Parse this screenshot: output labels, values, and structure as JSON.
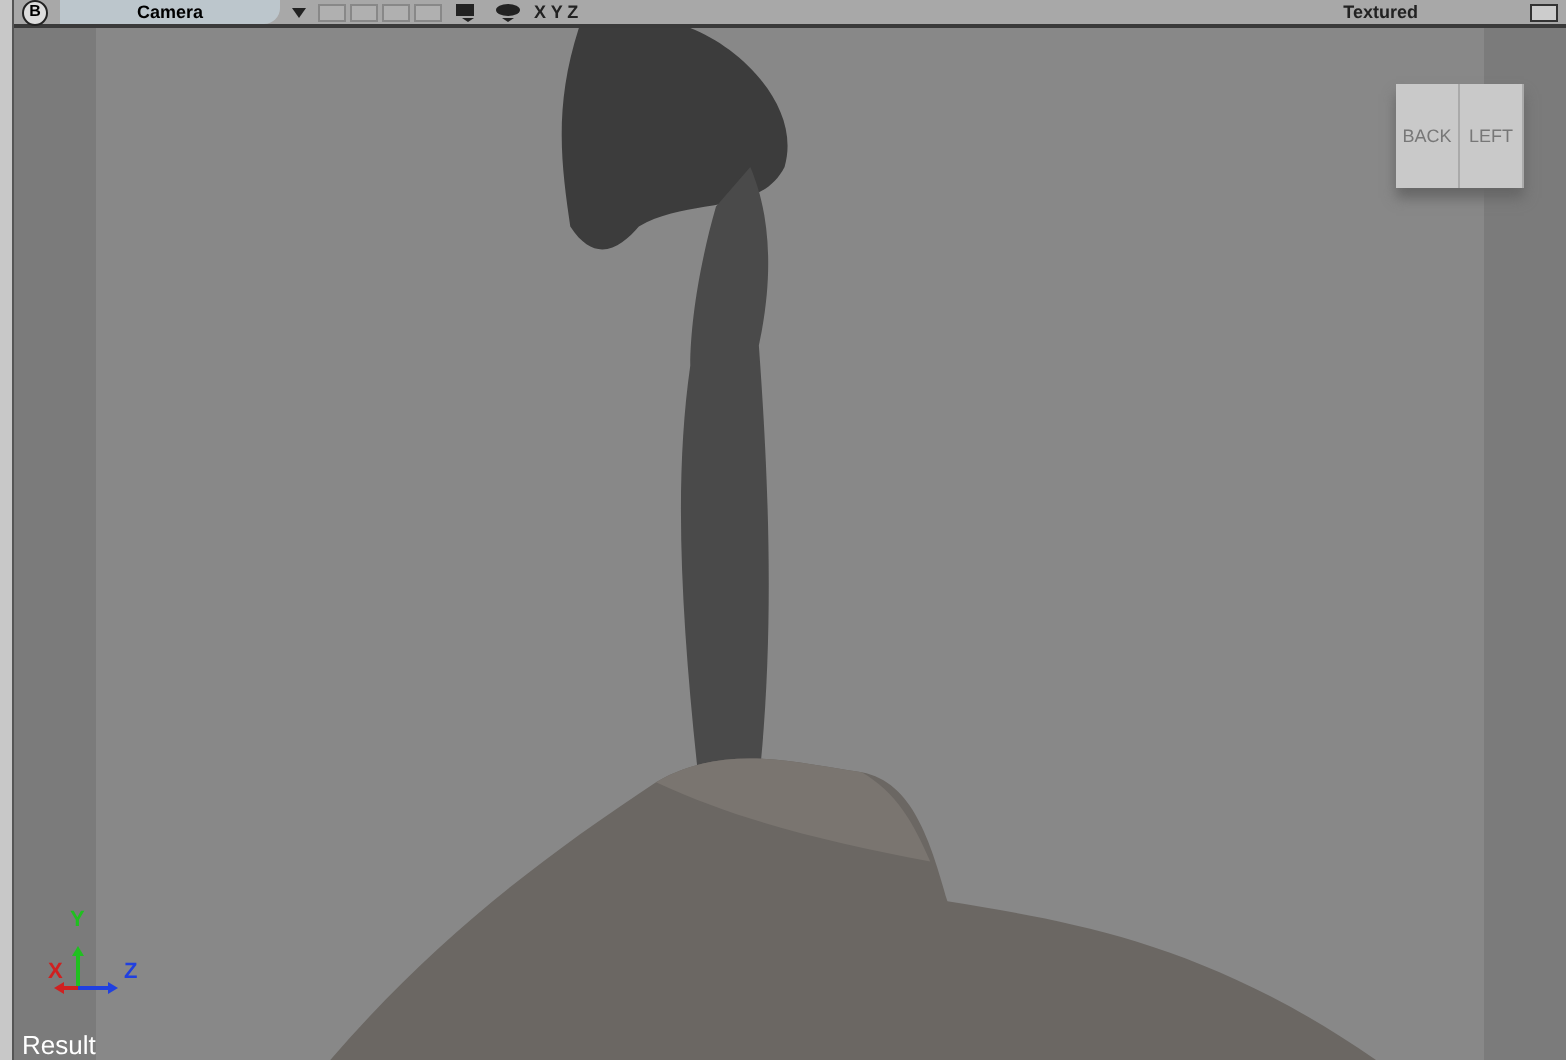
{
  "toolbar": {
    "view_badge": "B",
    "camera_menu": "Camera",
    "axes_label": "X Y Z",
    "shading_menu": "Textured"
  },
  "view_cube": {
    "faces": [
      "BACK",
      "LEFT"
    ]
  },
  "axis_gizmo": {
    "labels": [
      "X",
      "Y",
      "Z"
    ]
  },
  "viewport_label": "Result"
}
